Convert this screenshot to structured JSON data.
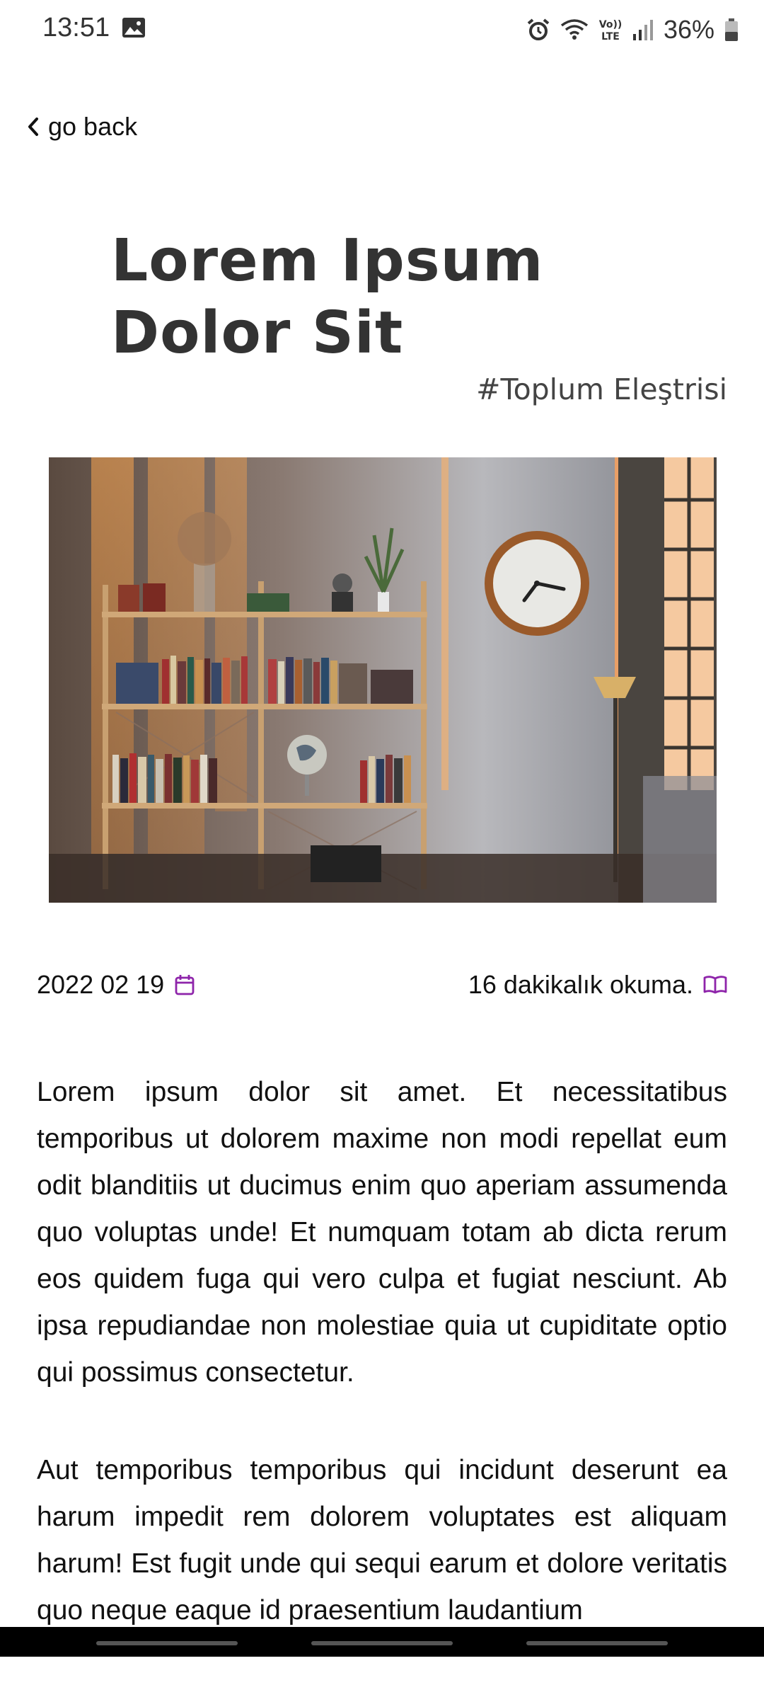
{
  "status_bar": {
    "time": "13:51",
    "battery": "36%",
    "icons": [
      "gallery-icon",
      "alarm-icon",
      "wifi-icon",
      "volte-icon",
      "signal-icon",
      "battery-icon"
    ]
  },
  "nav": {
    "back_label": "go back"
  },
  "article": {
    "title": "Lorem Ipsum Dolor Sit",
    "category": "#Toplum Eleştrisi",
    "date": "2022 02 19",
    "read_time": "16 dakikalık okuma.",
    "paragraphs": [
      "Lorem ipsum dolor sit amet. Et necessitatibus temporibus ut dolorem maxime non modi repellat eum odit blanditiis ut ducimus enim quo aperiam assumenda quo voluptas unde! Et numquam totam ab dicta rerum eos quidem fuga qui vero culpa et fugiat nesciunt. Ab ipsa repudiandae non molestiae quia ut cupiditate optio qui possimus consectetur.",
      "Aut temporibus temporibus qui incidunt deserunt ea harum impedit rem dolorem voluptates est aliquam harum! Est fugit unde qui sequi earum et dolore veritatis quo neque eaque id praesentium laudantium"
    ]
  },
  "colors": {
    "accent": "#8e24aa",
    "title": "#333333"
  }
}
